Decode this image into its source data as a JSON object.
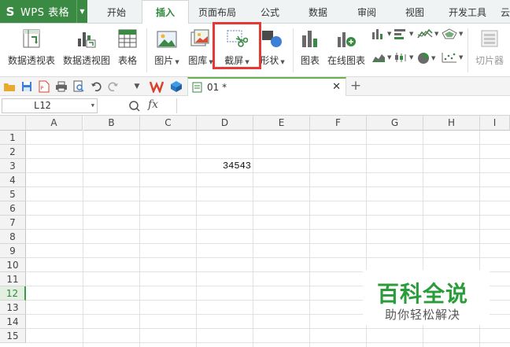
{
  "app": {
    "title": "WPS 表格",
    "logo": "S"
  },
  "menu": {
    "tabs": [
      "开始",
      "插入",
      "页面布局",
      "公式",
      "数据",
      "审阅",
      "视图",
      "开发工具",
      "云"
    ],
    "active": "插入"
  },
  "ribbon": {
    "pivot_table": "数据透视表",
    "pivot_chart": "数据透视图",
    "table": "表格",
    "picture": "图片",
    "gallery": "图库",
    "screenshot": "截屏",
    "shapes": "形状",
    "chart": "图表",
    "online_chart": "在线图表",
    "slicer": "切片器"
  },
  "document": {
    "tab_label": "01 *"
  },
  "formula_bar": {
    "cell_ref": "L12",
    "fx": "fx",
    "value": ""
  },
  "sheet": {
    "columns": [
      "A",
      "B",
      "C",
      "D",
      "E",
      "F",
      "G",
      "H",
      "I"
    ],
    "rows": [
      "1",
      "2",
      "3",
      "4",
      "5",
      "6",
      "7",
      "8",
      "9",
      "10",
      "11",
      "12",
      "13",
      "14",
      "15"
    ],
    "selected_row": "12",
    "cells": {
      "D3": "34543"
    }
  },
  "watermark": {
    "title": "百科全说",
    "subtitle": "助你轻松解决"
  },
  "colors": {
    "brand_green": "#3a8a43",
    "highlight_red": "#e53935",
    "watermark_green": "#2b9c3a"
  }
}
